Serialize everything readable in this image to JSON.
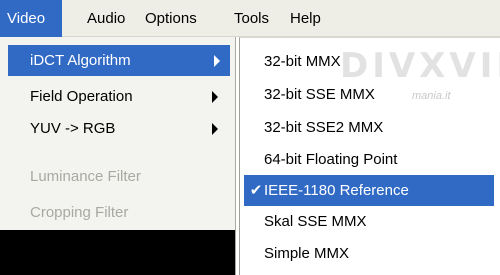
{
  "menubar": {
    "video": "Video",
    "audio": "Audio",
    "options": "Options",
    "tools": "Tools",
    "help": "Help"
  },
  "video_menu": {
    "items": [
      {
        "label": "iDCT Algorithm",
        "has_submenu": true,
        "highlighted": true,
        "enabled": true
      },
      {
        "label": "Field Operation",
        "has_submenu": true,
        "enabled": true
      },
      {
        "label": "YUV -> RGB",
        "has_submenu": true,
        "enabled": true
      },
      {
        "label": "Luminance Filter",
        "has_submenu": false,
        "enabled": false
      },
      {
        "label": "Cropping Filter",
        "has_submenu": false,
        "enabled": false
      }
    ]
  },
  "idct_submenu": {
    "items": [
      {
        "label": "32-bit MMX"
      },
      {
        "label": "32-bit SSE MMX"
      },
      {
        "label": "32-bit SSE2 MMX"
      },
      {
        "label": "64-bit Floating Point"
      },
      {
        "label": "IEEE-1180 Reference",
        "checked": true,
        "highlighted": true
      },
      {
        "label": "Skal SSE MMX"
      },
      {
        "label": "Simple MMX"
      }
    ],
    "check_glyph": "✔"
  },
  "watermark": {
    "text": "DIVXVID",
    "sub": "mania.it"
  },
  "colors": {
    "highlight": "#316ac5",
    "menubar_bg": "#eeede6",
    "menu_bg": "#f3f3ef",
    "disabled_text": "#a9a9a4"
  }
}
